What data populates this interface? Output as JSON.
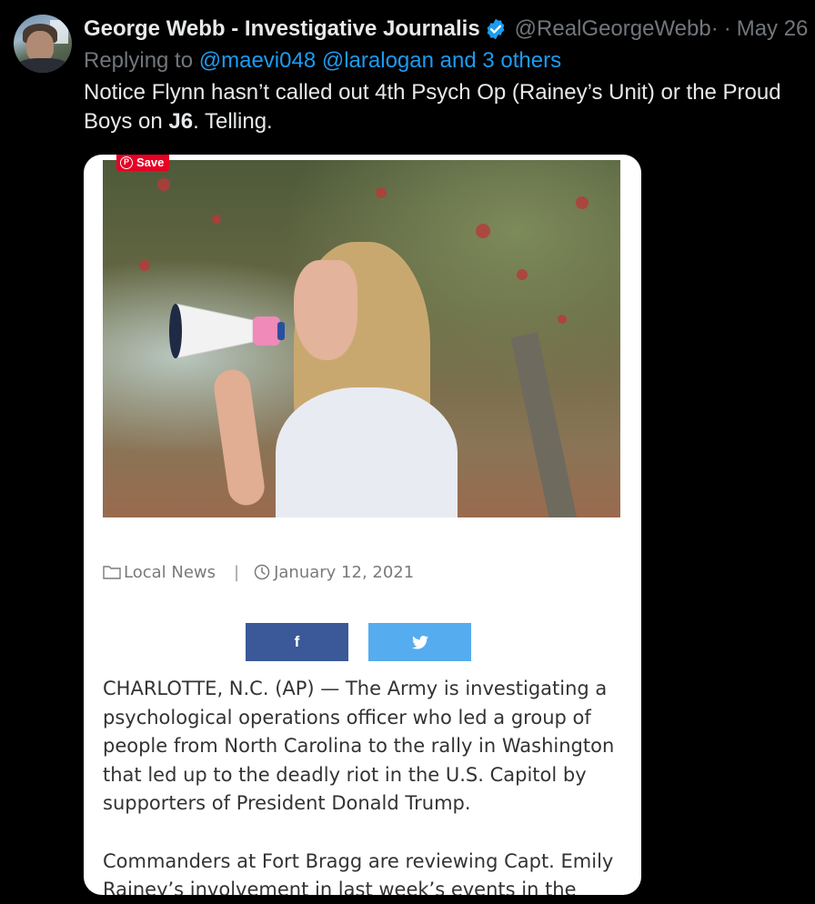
{
  "tweet": {
    "author": {
      "display_name": "George Webb - Investigative Journalis",
      "handle": "@RealGeorgeWebb·",
      "avatar_icon": "user-avatar",
      "verified_color": "#1d9bf0"
    },
    "date": "May 26",
    "separator": "·",
    "reply": {
      "prefix": "Replying to ",
      "user1": "@maevi048",
      "user2": "@laralogan",
      "others": "and 3 others"
    },
    "text": {
      "part1": "Notice Flynn hasn’t called out 4th Psych Op (Rainey’s Unit) or the Proud Boys on ",
      "bold": "J6",
      "part2": ". Telling."
    }
  },
  "embedded_article": {
    "pinterest_save_label": "Save",
    "pinterest_icon_glyph": "P",
    "category": "Local News",
    "category_separator": "|",
    "date": "January 12, 2021",
    "share": {
      "facebook_glyph": "f",
      "facebook_color": "#3b5998",
      "twitter_color": "#55acee"
    },
    "paragraphs": [
      "CHARLOTTE, N.C. (AP) — The Army is investigating a psychological operations officer who led a group of people from North Carolina to the rally in Washington that led up to the deadly riot in the U.S. Capitol by supporters of President Donald Trump.",
      "Commanders at Fort Bragg are reviewing Capt. Emily Rainey’s involvement in last week’s events in the"
    ]
  }
}
